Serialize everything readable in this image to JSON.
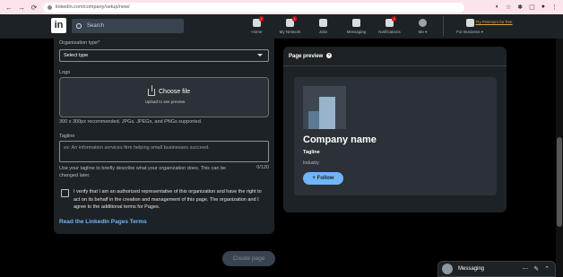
{
  "browser": {
    "url": "linkedin.com/company/setup/new/"
  },
  "header": {
    "logo": "in",
    "search_placeholder": "Search",
    "nav": [
      {
        "label": "Home",
        "badge": ""
      },
      {
        "label": "My Network",
        "badge": ""
      },
      {
        "label": "Jobs",
        "badge": ""
      },
      {
        "label": "Messaging",
        "badge": ""
      },
      {
        "label": "Notifications",
        "badge": ""
      },
      {
        "label": "Me ▾",
        "badge": ""
      },
      {
        "label": "For Business ▾",
        "badge": ""
      }
    ],
    "premium": "Try Premium for free"
  },
  "form": {
    "org_type_label": "Organization type*",
    "org_type_value": "Select type",
    "logo_label": "Logo",
    "choose_file": "Choose file",
    "upload_hint": "Upload to see preview",
    "logo_help": "300 x 300px recommended. JPGs, JPEGs, and PNGs supported.",
    "tagline_label": "Tagline",
    "tagline_placeholder": "ex: An information services firm helping small businesses succeed.",
    "tagline_help": "Use your tagline to briefly describe what your organization does. This can be changed later.",
    "tagline_counter": "0/120",
    "verify_text": "I verify that I am an authorized representative of this organization and have the right to act on its behalf in the creation and management of this page. The organization and I agree to the additional terms for Pages.",
    "terms_link": "Read the LinkedIn Pages Terms",
    "create_button": "Create page"
  },
  "preview": {
    "title": "Page preview",
    "company_name": "Company name",
    "tagline": "Tagline",
    "industry": "Industry",
    "follow": "+ Follow"
  },
  "messaging": {
    "label": "Messaging"
  },
  "colors": {
    "accent": "#70b5f9",
    "premium": "#e7a33e",
    "panel": "#1d2226"
  }
}
